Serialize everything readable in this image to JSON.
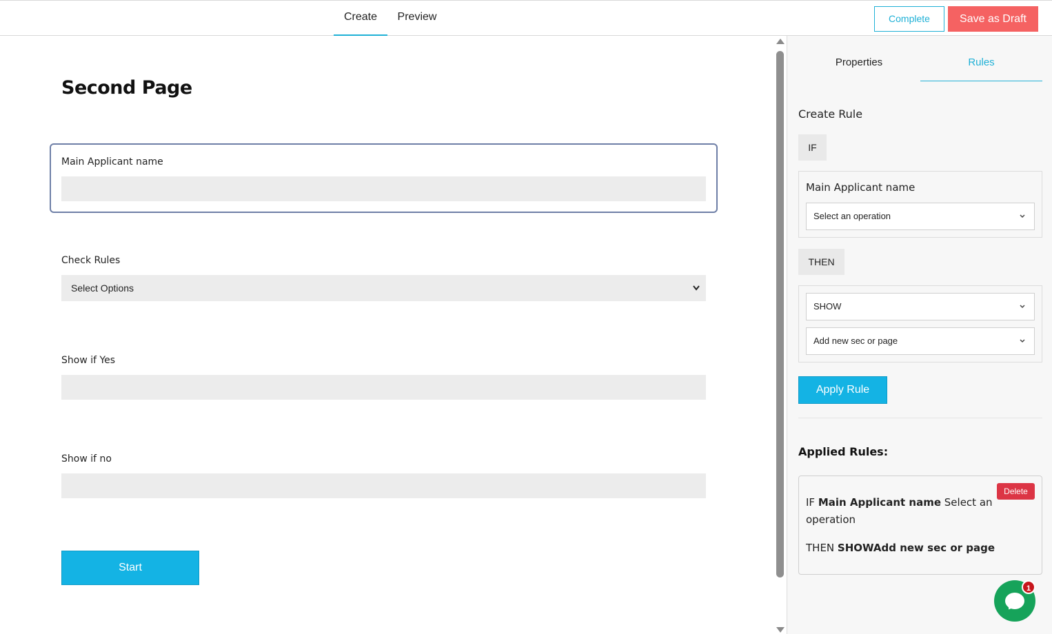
{
  "header": {
    "tabs": [
      {
        "label": "Create",
        "active": true
      },
      {
        "label": "Preview",
        "active": false
      }
    ],
    "complete_label": "Complete",
    "save_draft_label": "Save as Draft"
  },
  "form": {
    "page_title": "Second Page",
    "fields": [
      {
        "label": "Main Applicant name",
        "value": ""
      },
      {
        "label": "Check Rules",
        "select_value": "Select Options"
      },
      {
        "label": "Show if Yes",
        "value": ""
      },
      {
        "label": "Show if no",
        "value": ""
      }
    ],
    "start_label": "Start"
  },
  "panel": {
    "tabs": [
      {
        "label": "Properties",
        "active": false
      },
      {
        "label": "Rules",
        "active": true
      }
    ],
    "create_rule_title": "Create Rule",
    "if_label": "IF",
    "if_field_name": "Main Applicant name",
    "operation_select": "Select an operation",
    "then_label": "THEN",
    "action_select": "SHOW",
    "target_select": "Add new sec or page",
    "apply_label": "Apply Rule",
    "applied_title": "Applied Rules:",
    "applied_rule": {
      "delete_label": "Delete",
      "if_prefix": "IF",
      "if_field": "Main Applicant name",
      "if_operation": "Select an",
      "if_operation_cont": "operation",
      "then_prefix": "THEN",
      "then_value": "SHOWAdd new sec or page"
    }
  },
  "chat": {
    "badge_count": "1"
  },
  "colors": {
    "accent": "#1eb0d6",
    "draft": "#f56262",
    "delete": "#dc3545",
    "chat": "#16a35a"
  }
}
